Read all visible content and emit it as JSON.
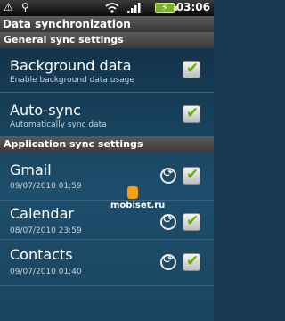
{
  "statusbar": {
    "left_icons": [
      "warning-icon",
      "usb-icon"
    ],
    "right_icons": [
      "wifi-icon",
      "signal-icon",
      "battery-icon"
    ],
    "time": "03:06"
  },
  "title": "Data synchronization",
  "sections": {
    "general": "General sync settings",
    "application": "Application sync settings"
  },
  "general_items": [
    {
      "title": "Background data",
      "subtitle": "Enable background data usage",
      "checked": true
    },
    {
      "title": "Auto-sync",
      "subtitle": "Automatically sync data",
      "checked": true
    }
  ],
  "app_items": [
    {
      "title": "Gmail",
      "subtitle": "09/07/2010 01:59",
      "checked": true
    },
    {
      "title": "Calendar",
      "subtitle": "08/07/2010 23:59",
      "checked": true
    },
    {
      "title": "Contacts",
      "subtitle": "09/07/2010 01:40",
      "checked": true
    }
  ],
  "watermark": "mobiset.ru",
  "colors": {
    "accent": "#64b400",
    "background": "#173a52"
  }
}
